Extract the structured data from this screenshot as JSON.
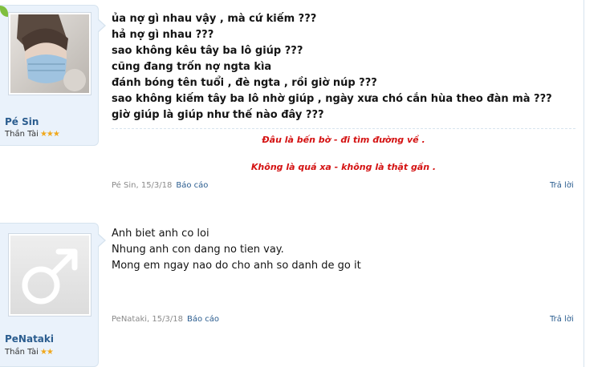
{
  "posts": [
    {
      "user": {
        "name": "Pé Sin",
        "title": "Thần Tài",
        "stars": "★★★"
      },
      "lines": [
        "ủa nợ gì nhau vậy , mà cứ kiếm ???",
        "hả nợ gì nhau ???",
        "sao không kêu tây ba lô giúp ???",
        "cũng đang trốn nợ ngta kìa",
        "đánh bóng tên tuổi , đè ngta , rồi giờ núp ???",
        "sao không kiếm tây ba lô nhờ giúp , ngày xưa chó cắn hùa theo đàn mà ???",
        "giờ giúp là giúp như thế nào đây ???"
      ],
      "signature": [
        "Đâu là bến bờ - đi tìm đường về .",
        "Không là quá xa - không là thật gần ."
      ],
      "meta": {
        "author_date": "Pé Sin, 15/3/18",
        "report": "Báo cáo",
        "reply": "Trả lời"
      }
    },
    {
      "user": {
        "name": "PeNataki",
        "title": "Thần Tài",
        "stars": "★★"
      },
      "lines": [
        "Anh biet anh co loi",
        "Nhung anh con dang no tien vay.",
        "Mong em ngay nao do cho anh so danh de go it"
      ],
      "meta": {
        "author_date": "PeNataki, 15/3/18",
        "report": "Báo cáo",
        "reply": "Trả lời"
      }
    }
  ],
  "colors": {
    "accent": "#2b5d8f",
    "signature": "#d41212",
    "userblock_bg": "#eaf2fb"
  },
  "icons": {
    "post2_avatar": "male-symbol-icon",
    "post1_corner": "leaf-icon"
  }
}
